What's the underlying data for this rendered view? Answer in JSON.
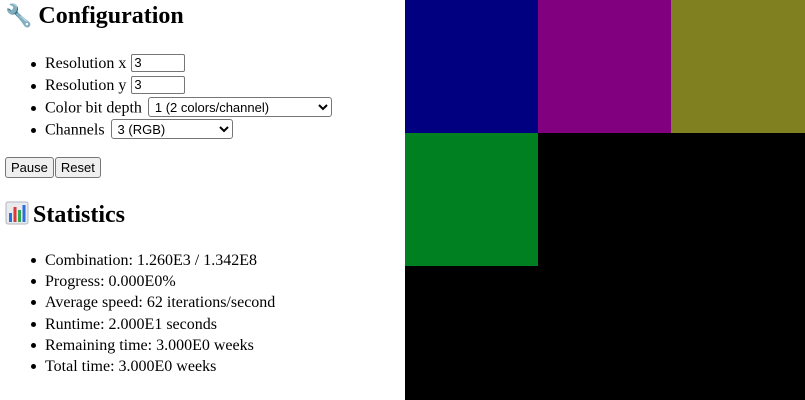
{
  "config": {
    "heading": "Configuration",
    "icon": "wrench-icon",
    "resolution_x_label": "Resolution x",
    "resolution_x_value": "3",
    "resolution_y_label": "Resolution y",
    "resolution_y_value": "3",
    "bit_depth_label": "Color bit depth",
    "bit_depth_selected": "1 (2 colors/channel)",
    "channels_label": "Channels",
    "channels_selected": "3 (RGB)"
  },
  "buttons": {
    "pause_label": "Pause",
    "reset_label": "Reset"
  },
  "stats": {
    "heading": "Statistics",
    "icon": "bar-chart-icon",
    "items": [
      "Combination: 1.260E3 / 1.342E8",
      "Progress: 0.000E0%",
      "Average speed: 62 iterations/second",
      "Runtime: 2.000E1 seconds",
      "Remaining time: 3.000E0 weeks",
      "Total time: 3.000E0 weeks"
    ]
  },
  "canvas": {
    "pixels": [
      [
        "#000080",
        "#800080",
        "#808020"
      ],
      [
        "#008020",
        "#000000",
        "#000000"
      ],
      [
        "#000000",
        "#000000",
        "#000000"
      ]
    ]
  }
}
